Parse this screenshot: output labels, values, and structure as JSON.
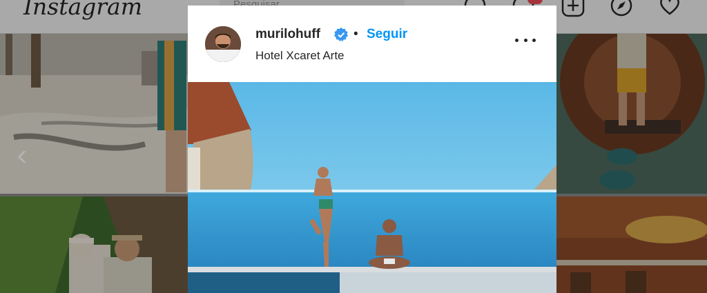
{
  "nav": {
    "logo": "Instagram",
    "search_placeholder": "Pesquisar",
    "icons": [
      "messenger-icon",
      "explore-activity-icon",
      "new-post-icon",
      "compass-icon",
      "heart-icon"
    ],
    "badge_color": "#ed4956"
  },
  "post": {
    "username": "murilohuff",
    "verified": true,
    "separator": "•",
    "follow_label": "Seguir",
    "location": "Hotel Xcaret Arte",
    "accent_color": "#0095f6"
  },
  "background": {
    "prev_arrow": "‹"
  }
}
